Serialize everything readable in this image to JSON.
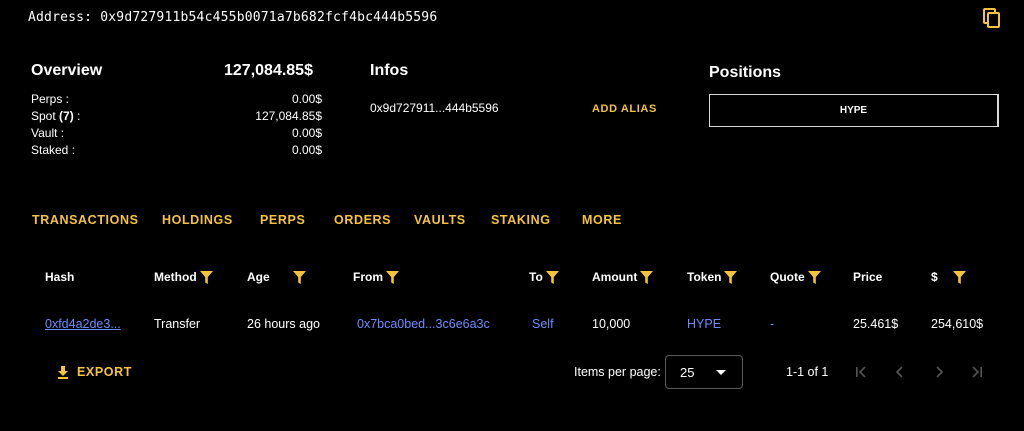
{
  "address_line": "Address: 0x9d727911b54c455b0071a7b682fcf4bc444b5596",
  "overview": {
    "title": "Overview",
    "total": "127,084.85$",
    "rows": [
      {
        "label": "Perps :",
        "value": "0.00$"
      },
      {
        "label_prefix": "Spot ",
        "label_count": "(7)",
        "label_suffix": " :",
        "value": "127,084.85$"
      },
      {
        "label": "Vault :",
        "value": "0.00$"
      },
      {
        "label": "Staked :",
        "value": "0.00$"
      }
    ]
  },
  "infos": {
    "title": "Infos",
    "address_short": "0x9d727911...444b5596",
    "add_alias": "ADD ALIAS"
  },
  "positions": {
    "title": "Positions",
    "items": [
      "HYPE"
    ]
  },
  "tabs": [
    "TRANSACTIONS",
    "HOLDINGS",
    "PERPS",
    "ORDERS",
    "VAULTS",
    "STAKING",
    "MORE"
  ],
  "table": {
    "headers": [
      "Hash",
      "Method",
      "Age",
      "From",
      "To",
      "Amount",
      "Token",
      "Quote",
      "Price",
      "$"
    ],
    "rows": [
      {
        "hash": "0xfd4a2de3...",
        "method": "Transfer",
        "age": "26 hours ago",
        "from": "0x7bca0bed...3c6e6a3c",
        "to": "Self",
        "amount": "10,000",
        "token": "HYPE",
        "quote": "-",
        "price": "25.461$",
        "usd": "254,610$"
      }
    ]
  },
  "footer": {
    "export": "EXPORT",
    "items_per_page_label": "Items per page:",
    "items_per_page_value": "25",
    "range": "1-1 of 1"
  },
  "colors": {
    "accent": "#f5c33b",
    "link": "#6b8cff",
    "background": "#000000"
  },
  "icons": [
    "copy-icon",
    "filter-icon",
    "download-icon",
    "first-page-icon",
    "prev-page-icon",
    "next-page-icon",
    "last-page-icon"
  ]
}
